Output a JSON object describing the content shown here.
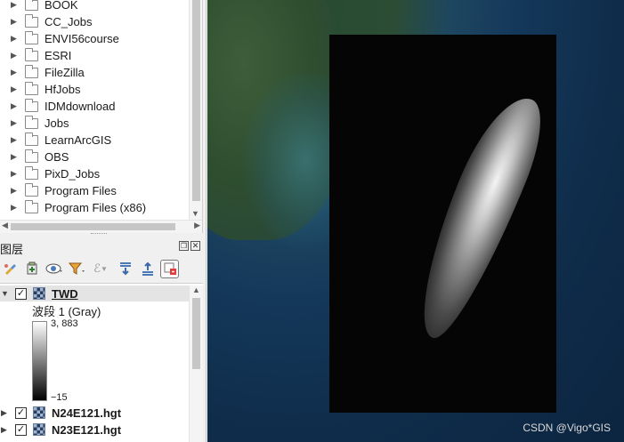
{
  "browser": {
    "items": [
      {
        "label": "BOOK"
      },
      {
        "label": "CC_Jobs"
      },
      {
        "label": "ENVI56course"
      },
      {
        "label": "ESRI"
      },
      {
        "label": "FileZilla"
      },
      {
        "label": "HfJobs"
      },
      {
        "label": "IDMdownload"
      },
      {
        "label": "Jobs"
      },
      {
        "label": "LearnArcGIS"
      },
      {
        "label": "OBS"
      },
      {
        "label": "PixD_Jobs"
      },
      {
        "label": "Program Files"
      },
      {
        "label": "Program Files (x86)"
      }
    ]
  },
  "layers_panel": {
    "title": "图层",
    "toolbar_icons": [
      "style-manager-icon",
      "add-group-icon",
      "visibility-icon",
      "filter-icon",
      "expression-filter-icon",
      "expand-all-icon",
      "collapse-all-icon",
      "remove-layer-icon"
    ],
    "layers": [
      {
        "name": "TWD",
        "checked": true,
        "selected": true,
        "expanded": true,
        "band_label": "波段 1 (Gray)",
        "ramp_max": "3, 883",
        "ramp_min": "−15"
      },
      {
        "name": "N24E121.hgt",
        "checked": true
      },
      {
        "name": "N23E121.hgt",
        "checked": true
      }
    ]
  },
  "map": {
    "watermark": "CSDN @Vigo*GIS"
  }
}
